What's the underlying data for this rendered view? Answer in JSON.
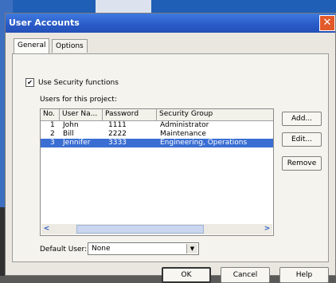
{
  "window": {
    "title": "User Accounts",
    "close_glyph": "✕"
  },
  "tabs": [
    {
      "label": "General",
      "active": true
    },
    {
      "label": "Options",
      "active": false
    }
  ],
  "security": {
    "label": "Use Security functions",
    "checked": true,
    "check_glyph": "✔"
  },
  "users": {
    "label": "Users for this project:",
    "columns": [
      "No.",
      "User Na...",
      "Password",
      "Security Group"
    ],
    "rows": [
      {
        "no": "1",
        "user": "John",
        "password": "1111",
        "group": "Administrator",
        "selected": false
      },
      {
        "no": "2",
        "user": "Bill",
        "password": "2222",
        "group": "Maintenance",
        "selected": false
      },
      {
        "no": "3",
        "user": "Jennifer",
        "password": "3333",
        "group": "Engineering, Operations",
        "selected": true
      }
    ],
    "scroll_left": "<",
    "scroll_right": ">"
  },
  "side_buttons": {
    "add": "Add...",
    "edit": "Edit...",
    "remove": "Remove"
  },
  "default_user": {
    "label": "Default User:",
    "value": "None",
    "arrow": "▼"
  },
  "bottom_buttons": {
    "ok": "OK",
    "cancel": "Cancel",
    "help": "Help"
  },
  "colors": {
    "title_bar": "#2a5cc8",
    "selection": "#3a6ed2",
    "close": "#e25a2a"
  }
}
